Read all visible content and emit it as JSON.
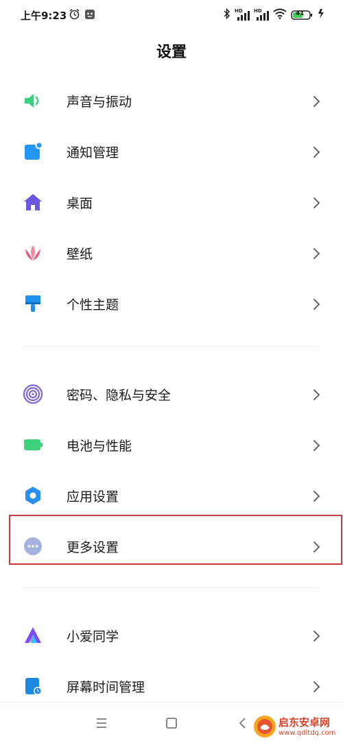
{
  "status_bar": {
    "time": "上午9:23",
    "battery": "41",
    "signal_label": "HD"
  },
  "header": {
    "title": "设置"
  },
  "groups": [
    {
      "items": [
        {
          "label": "声音与振动",
          "icon": "speaker-icon",
          "color": "#3ccf7f"
        },
        {
          "label": "通知管理",
          "icon": "notification-icon",
          "color": "#2196f3"
        },
        {
          "label": "桌面",
          "icon": "home-icon",
          "color": "#6a57e0"
        },
        {
          "label": "壁纸",
          "icon": "tulip-icon",
          "color": "#ef5b7a"
        },
        {
          "label": "个性主题",
          "icon": "brush-icon",
          "color": "#1e90f0"
        }
      ]
    },
    {
      "items": [
        {
          "label": "密码、隐私与安全",
          "icon": "fingerprint-icon",
          "color": "#7e67d9"
        },
        {
          "label": "电池与性能",
          "icon": "battery-icon",
          "color": "#3ed27d"
        },
        {
          "label": "应用设置",
          "icon": "gear-icon",
          "color": "#2b8ff0"
        },
        {
          "label": "更多设置",
          "icon": "more-icon",
          "color": "#a5b3dc"
        }
      ]
    },
    {
      "items": [
        {
          "label": "小爱同学",
          "icon": "xiaoai-icon",
          "color": "#7c4dff"
        },
        {
          "label": "屏幕时间管理",
          "icon": "screen-time-icon",
          "color": "#1e88e5"
        }
      ]
    }
  ],
  "highlight_color": "#c43a3a",
  "watermark": {
    "title": "启东安卓网",
    "url": "www.qdltdq.com"
  }
}
